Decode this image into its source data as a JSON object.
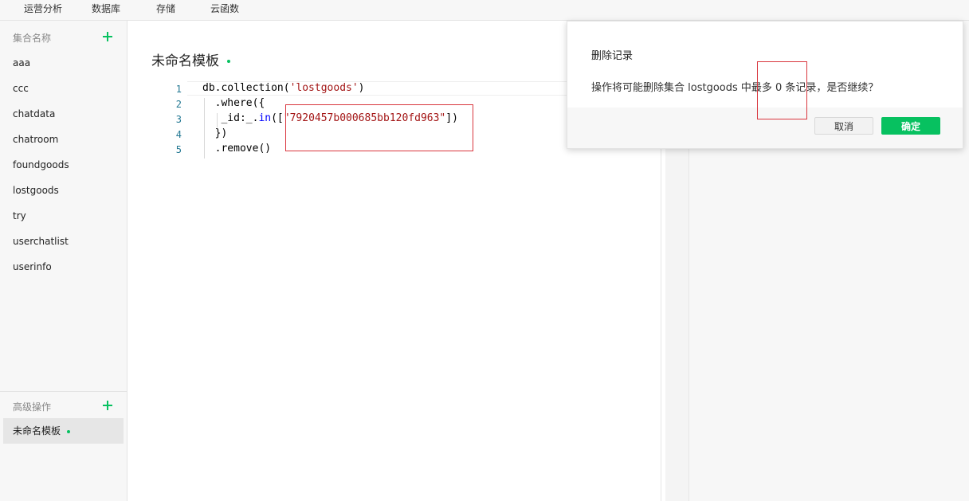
{
  "topnav": {
    "tabs": [
      "运营分析",
      "数据库",
      "存储",
      "云函数"
    ]
  },
  "sidebar": {
    "collections_title": "集合名称",
    "collections": [
      "aaa",
      "ccc",
      "chatdata",
      "chatroom",
      "foundgoods",
      "lostgoods",
      "try",
      "userchatlist",
      "userinfo"
    ],
    "advanced_title": "高级操作",
    "active_template": "未命名模板"
  },
  "main": {
    "title": "未命名模板"
  },
  "editor": {
    "line_numbers": [
      "1",
      "2",
      "3",
      "4",
      "5"
    ],
    "lines": {
      "l1_a": "db.collection(",
      "l1_str": "'lostgoods'",
      "l1_b": ")",
      "l2": "  .where({",
      "l3_a": "   _id:_.",
      "l3_kw": "in",
      "l3_b": "([",
      "l3_str": "\"7920457b000685bb120fd963\"",
      "l3_c": "])",
      "l4": "  })",
      "l5": "  .remove()"
    }
  },
  "dialog": {
    "title": "删除记录",
    "message": "操作将可能删除集合 lostgoods 中最多 0 条记录，是否继续？",
    "cancel_label": "取消",
    "ok_label": "确定"
  },
  "colors": {
    "accent": "#07c160",
    "annotation_red": "#d9363e"
  }
}
